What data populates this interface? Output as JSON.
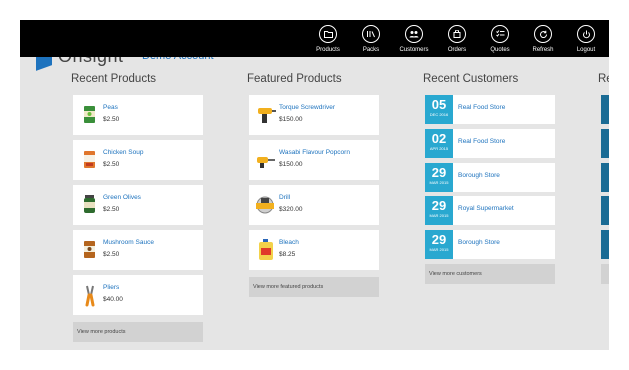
{
  "app": {
    "logo_text": "Onsight",
    "account_text": "Demo Account"
  },
  "nav": [
    {
      "label": "Products",
      "icon": "folder-icon"
    },
    {
      "label": "Packs",
      "icon": "book-icon"
    },
    {
      "label": "Customers",
      "icon": "people-icon"
    },
    {
      "label": "Orders",
      "icon": "bag-icon"
    },
    {
      "label": "Quotes",
      "icon": "checklist-icon"
    },
    {
      "label": "Refresh",
      "icon": "refresh-icon"
    },
    {
      "label": "Logout",
      "icon": "power-icon"
    }
  ],
  "recent_products": {
    "title": "Recent Products",
    "items": [
      {
        "name": "Peas",
        "price": "$2.50",
        "icon": "can-icon"
      },
      {
        "name": "Chicken Soup",
        "price": "$2.50",
        "icon": "soup-can-icon"
      },
      {
        "name": "Green Olives",
        "price": "$2.50",
        "icon": "olive-jar-icon"
      },
      {
        "name": "Mushroom Sauce",
        "price": "$2.50",
        "icon": "sauce-can-icon"
      },
      {
        "name": "Pliers",
        "price": "$40.00",
        "icon": "pliers-icon"
      }
    ],
    "view_more": "View more products"
  },
  "featured_products": {
    "title": "Featured Products",
    "items": [
      {
        "name": "Torque Screwdriver",
        "price": "$150.00",
        "icon": "drill-icon"
      },
      {
        "name": "Wasabi Flavour Popcorn",
        "price": "$150.00",
        "icon": "screwdriver-icon"
      },
      {
        "name": "Drill",
        "price": "$320.00",
        "icon": "saw-icon"
      },
      {
        "name": "Bleach",
        "price": "$8.25",
        "icon": "bleach-icon"
      }
    ],
    "view_more": "View more featured products"
  },
  "recent_customers": {
    "title": "Recent Customers",
    "items": [
      {
        "day": "05",
        "month": "DEC 2016",
        "name": "Real Food Store"
      },
      {
        "day": "02",
        "month": "APR 2015",
        "name": "Real Food Store"
      },
      {
        "day": "29",
        "month": "MAR 2015",
        "name": "Borough Store"
      },
      {
        "day": "29",
        "month": "MAR 2015",
        "name": "Royal Supermarket"
      },
      {
        "day": "29",
        "month": "MAR 2015",
        "name": "Borough Store"
      }
    ],
    "view_more": "View more customers"
  },
  "edge_section": {
    "title": "Re"
  },
  "colors": {
    "accent": "#1e73be",
    "date_tile": "#29a8d0",
    "topbar": "#000000",
    "background": "#e5e5e5"
  }
}
